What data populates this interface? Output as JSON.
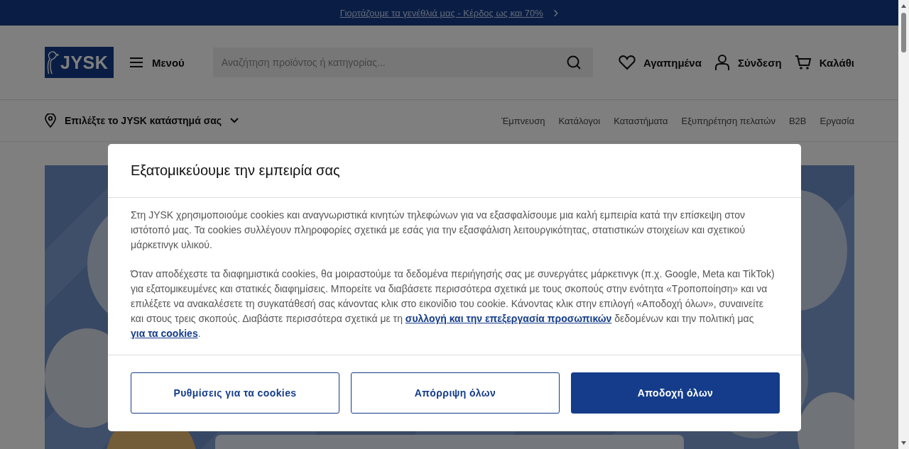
{
  "promo_bar": {
    "text": "Γιορτάζουμε τα γενέθλιά μας - Κέρδος ως και 70%",
    "chevron": "›"
  },
  "header": {
    "logo": "JYSK",
    "menu": "Μενού",
    "search": {
      "placeholder": "Αναζήτηση προϊόντος ή κατηγορίας..."
    },
    "actions": [
      {
        "kind": "heart",
        "label": "Αγαπημένα"
      },
      {
        "kind": "user",
        "label": "Σύνδεση"
      },
      {
        "kind": "cart",
        "label": "Καλάθι"
      }
    ]
  },
  "store_selector": "Επιλέξτε το JYSK κατάστημά σας",
  "nav_links": [
    "Έμπνευση",
    "Κατάλογοι",
    "Καταστήματα",
    "Εξυπηρέτηση πελατών",
    "B2B",
    "Εργασία"
  ],
  "cookie_dialog": {
    "title": "Εξατομικεύουμε την εμπειρία σας",
    "paragraph_1": "Στη JYSK χρησιμοποιούμε cookies και αναγνωριστικά κινητών τηλεφώνων για να εξασφαλίσουμε μια καλή εμπειρία κατά την επίσκεψη στον ιστότοπό μας. Τα cookies συλλέγουν πληροφορίες σχετικά με εσάς για την εξασφάλιση λειτουργικότητας, στατιστικών στοιχείων και σχετικού μάρκετινγκ υλικού.",
    "paragraph_2": [
      {
        "kind": "text",
        "text": "Όταν αποδέχεστε τα διαφημιστικά cookies, θα μοιραστούμε τα δεδομένα περιήγησής σας με συνεργάτες μάρκετινγκ (π.χ. Google, Meta και TikTok) για εξατομικευμένες και στατικές διαφημίσεις. Μπορείτε να διαβάσετε περισσότερα σχετικά με τους σκοπούς στην ενότητα «Τροποποίηση» και να επιλέξετε να ανακαλέσετε τη συγκατάθεσή σας κάνοντας κλικ στο εικονίδιο του cookie. Κάνοντας κλικ στην επιλογή «Αποδοχή όλων», συναινείτε και στους τρεις σκοπούς. Διαβάστε περισσότερα σχετικά με τη"
      },
      {
        "kind": "link",
        "text": "συλλογή και την επεξεργασία προσωπικών"
      },
      {
        "kind": "text",
        "text": "δεδομένων και την πολιτική μας"
      },
      {
        "kind": "link",
        "text": "για τα cookies"
      },
      {
        "kind": "text",
        "text": "."
      }
    ],
    "buttons": [
      {
        "label": "Ρυθμίσεις για τα cookies",
        "kind": "outline"
      },
      {
        "label": "Απόρριψη όλων",
        "kind": "outline"
      },
      {
        "label": "Αποδοχή όλων",
        "kind": "primary"
      }
    ]
  }
}
